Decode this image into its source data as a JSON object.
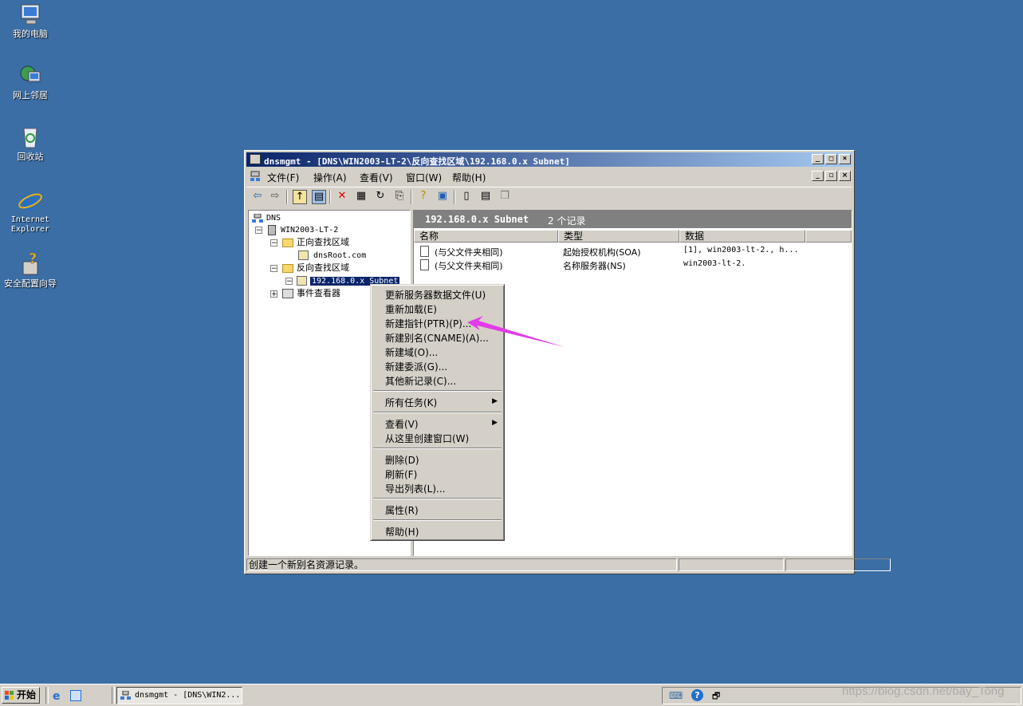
{
  "desktop": {
    "icons": [
      {
        "label": "我的电脑",
        "icon": "my-computer-icon"
      },
      {
        "label": "网上邻居",
        "icon": "network-icon"
      },
      {
        "label": "回收站",
        "icon": "recycle-bin-icon"
      },
      {
        "label": "Internet\nExplorer",
        "icon": "ie-icon"
      },
      {
        "label": "安全配置向导",
        "icon": "security-wizard-icon"
      }
    ]
  },
  "window": {
    "title": "dnsmgmt - [DNS\\WIN2003-LT-2\\反向查找区域\\192.168.0.x Subnet]",
    "menu": [
      "文件(F)",
      "操作(A)",
      "查看(V)",
      "窗口(W)",
      "帮助(H)"
    ]
  },
  "tree": {
    "root": "DNS",
    "server": "WIN2003-LT-2",
    "forward_zones": "正向查找区域",
    "forward_child": "dnsRoot.com",
    "reverse_zones": "反向查找区域",
    "reverse_child": "192.168.0.x Subnet",
    "event_viewer": "事件查看器"
  },
  "details": {
    "zone_name": "192.168.0.x Subnet",
    "record_count": "2 个记录",
    "columns": [
      "名称",
      "类型",
      "数据"
    ],
    "rows": [
      [
        "(与父文件夹相同)",
        "起始授权机构(SOA)",
        "[1], win2003-lt-2., h..."
      ],
      [
        "(与父文件夹相同)",
        "名称服务器(NS)",
        "win2003-lt-2."
      ]
    ]
  },
  "status_bar": {
    "text": "创建一个新别名资源记录。"
  },
  "context_menu": {
    "items": [
      "更新服务器数据文件(U)",
      "重新加载(E)",
      "新建指针(PTR)(P)...",
      "新建别名(CNAME)(A)...",
      "新建域(O)...",
      "新建委派(G)...",
      "其他新记录(C)...",
      "所有任务(K)",
      "查看(V)",
      "从这里创建窗口(W)",
      "删除(D)",
      "刷新(F)",
      "导出列表(L)...",
      "属性(R)",
      "帮助(H)"
    ]
  },
  "taskbar": {
    "start": "开始",
    "task": "dnsmgmt - [DNS\\WIN2..."
  },
  "watermark": "https://blog.csdn.net/bay_Tong",
  "annotation": {
    "arrow_color": "#e23be8"
  }
}
